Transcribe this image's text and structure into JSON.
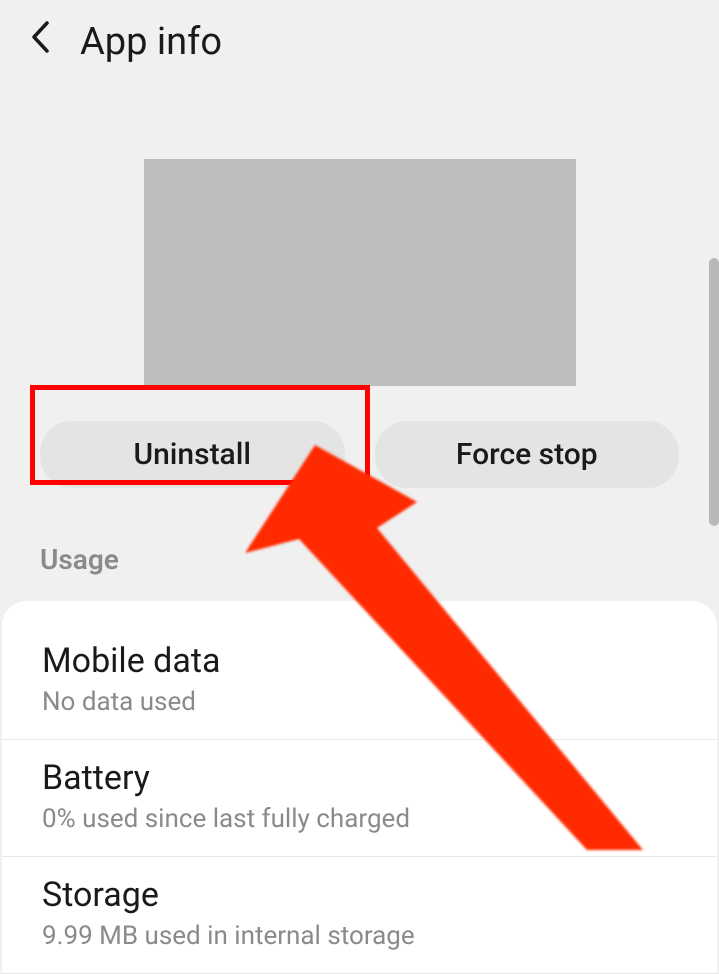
{
  "header": {
    "title": "App info"
  },
  "buttons": {
    "uninstall": "Uninstall",
    "forceStop": "Force stop"
  },
  "section": {
    "usage_label": "Usage"
  },
  "usage": [
    {
      "title": "Mobile data",
      "subtitle": "No data used"
    },
    {
      "title": "Battery",
      "subtitle": "0% used since last fully charged"
    },
    {
      "title": "Storage",
      "subtitle": "9.99 MB used in internal storage"
    }
  ],
  "annotation": {
    "arrow_color": "#ff2a00",
    "highlight_color": "#ff0000"
  }
}
